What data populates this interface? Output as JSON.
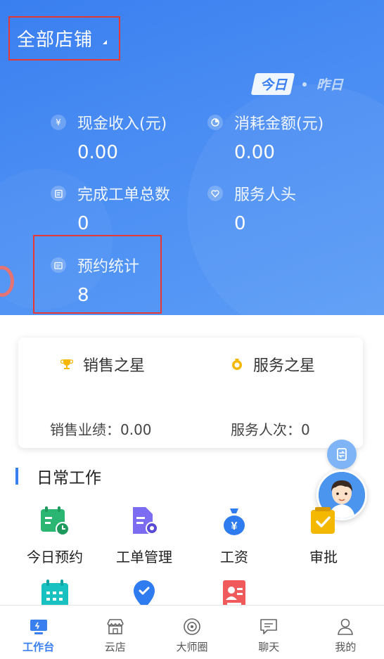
{
  "header": {
    "store_select_label": "全部店铺",
    "day_toggle": {
      "today": "今日",
      "yesterday": "昨日"
    },
    "stats": {
      "cash_income": {
        "label": "现金收入(元)",
        "value": "0.00",
        "icon": "yen-icon"
      },
      "consumption": {
        "label": "消耗金额(元)",
        "value": "0.00",
        "icon": "pie-chart-icon"
      },
      "orders_done": {
        "label": "完成工单总数",
        "value": "0",
        "icon": "clipboard-icon"
      },
      "service_heads": {
        "label": "服务人头",
        "value": "0",
        "icon": "heart-icon"
      },
      "appointments": {
        "label": "预约统计",
        "value": "8",
        "icon": "calendar-card-icon"
      }
    }
  },
  "stars": {
    "sales_title": "销售之星",
    "service_title": "服务之星",
    "sales_metric": "销售业绩：0.00",
    "service_metric": "服务人次：0",
    "trophy_color": "#f5b800",
    "medal_color": "#f5b800"
  },
  "daily_work": {
    "title": "日常工作",
    "items": [
      {
        "label": "今日预约",
        "icon": "calendar-clock-icon",
        "color": "#2bb673"
      },
      {
        "label": "工单管理",
        "icon": "document-gear-icon",
        "color": "#7c6cf2"
      },
      {
        "label": "工资",
        "icon": "money-bag-icon",
        "color": "#2f7bf0"
      },
      {
        "label": "审批",
        "icon": "check-folder-icon",
        "color": "#f5b800"
      }
    ],
    "second_row_icons": [
      {
        "icon": "calendar-grid-icon",
        "color": "#19c1c1"
      },
      {
        "icon": "location-pin-icon",
        "color": "#2f7bf0"
      },
      {
        "icon": "contact-card-icon",
        "color": "#f05a5a"
      }
    ]
  },
  "bottom_nav": [
    {
      "label": "工作台",
      "icon": "workbench-icon",
      "active": true
    },
    {
      "label": "云店",
      "icon": "store-icon",
      "active": false
    },
    {
      "label": "大师圈",
      "icon": "circle-icon",
      "active": false
    },
    {
      "label": "聊天",
      "icon": "chat-icon",
      "active": false
    },
    {
      "label": "我的",
      "icon": "user-icon",
      "active": false
    }
  ],
  "colors": {
    "primary": "#3a7ff0",
    "highlight_border": "#e53935"
  }
}
